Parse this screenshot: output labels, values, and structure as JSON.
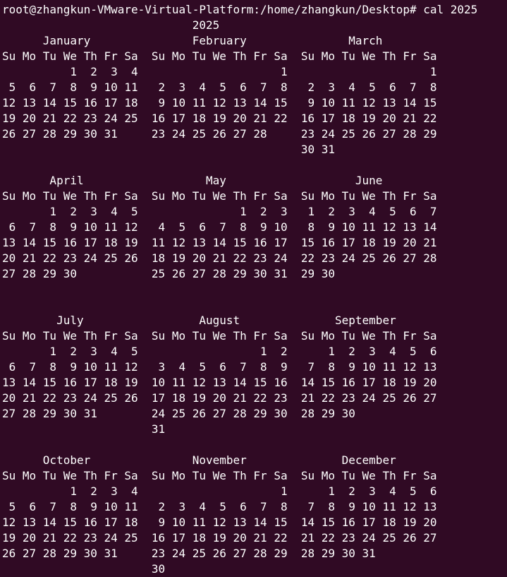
{
  "terminal": {
    "background": "#300A24",
    "foreground": "#FFFFFF",
    "prompt": "root@zhangkun-VMware-Virtual-Platform:/home/zhangkun/Desktop#",
    "command": "cal 2025",
    "output_lines": [
      "                            2025",
      "      January               February               March",
      "Su Mo Tu We Th Fr Sa  Su Mo Tu We Th Fr Sa  Su Mo Tu We Th Fr Sa",
      "          1  2  3  4                     1                     1",
      " 5  6  7  8  9 10 11   2  3  4  5  6  7  8   2  3  4  5  6  7  8",
      "12 13 14 15 16 17 18   9 10 11 12 13 14 15   9 10 11 12 13 14 15",
      "19 20 21 22 23 24 25  16 17 18 19 20 21 22  16 17 18 19 20 21 22",
      "26 27 28 29 30 31     23 24 25 26 27 28     23 24 25 26 27 28 29",
      "                                            30 31",
      "",
      "       April                  May                   June",
      "Su Mo Tu We Th Fr Sa  Su Mo Tu We Th Fr Sa  Su Mo Tu We Th Fr Sa",
      "       1  2  3  4  5               1  2  3   1  2  3  4  5  6  7",
      " 6  7  8  9 10 11 12   4  5  6  7  8  9 10   8  9 10 11 12 13 14",
      "13 14 15 16 17 18 19  11 12 13 14 15 16 17  15 16 17 18 19 20 21",
      "20 21 22 23 24 25 26  18 19 20 21 22 23 24  22 23 24 25 26 27 28",
      "27 28 29 30           25 26 27 28 29 30 31  29 30",
      "",
      "",
      "        July                 August              September",
      "Su Mo Tu We Th Fr Sa  Su Mo Tu We Th Fr Sa  Su Mo Tu We Th Fr Sa",
      "       1  2  3  4  5                  1  2      1  2  3  4  5  6",
      " 6  7  8  9 10 11 12   3  4  5  6  7  8  9   7  8  9 10 11 12 13",
      "13 14 15 16 17 18 19  10 11 12 13 14 15 16  14 15 16 17 18 19 20",
      "20 21 22 23 24 25 26  17 18 19 20 21 22 23  21 22 23 24 25 26 27",
      "27 28 29 30 31        24 25 26 27 28 29 30  28 29 30",
      "                      31",
      "",
      "      October               November              December",
      "Su Mo Tu We Th Fr Sa  Su Mo Tu We Th Fr Sa  Su Mo Tu We Th Fr Sa",
      "          1  2  3  4                     1      1  2  3  4  5  6",
      " 5  6  7  8  9 10 11   2  3  4  5  6  7  8   7  8  9 10 11 12 13",
      "12 13 14 15 16 17 18   9 10 11 12 13 14 15  14 15 16 17 18 19 20",
      "19 20 21 22 23 24 25  16 17 18 19 20 21 22  21 22 23 24 25 26 27",
      "26 27 28 29 30 31     23 24 25 26 27 28 29  28 29 30 31",
      "                      30"
    ]
  }
}
